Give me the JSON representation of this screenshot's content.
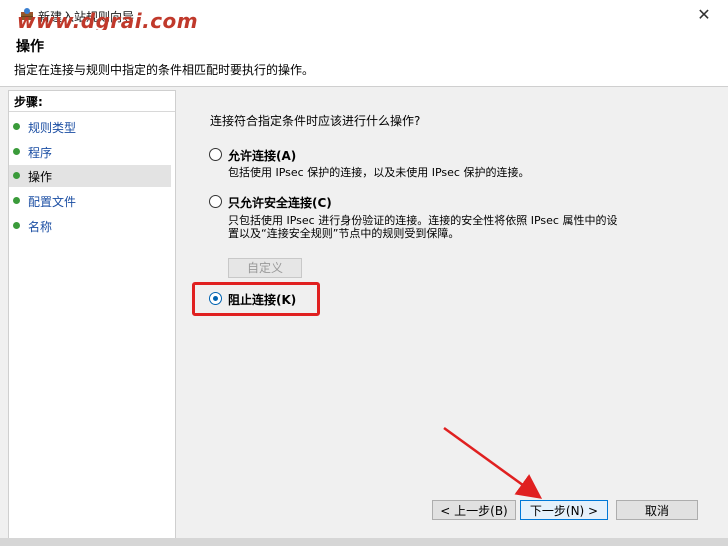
{
  "window": {
    "title": "新建入站规则向导"
  },
  "watermark": "www.dgrai.com",
  "header": {
    "title": "操作",
    "description": "指定在连接与规则中指定的条件相匹配时要执行的操作。"
  },
  "sidebar": {
    "heading": "步骤:",
    "items": [
      {
        "label": "规则类型"
      },
      {
        "label": "程序"
      },
      {
        "label": "操作"
      },
      {
        "label": "配置文件"
      },
      {
        "label": "名称"
      }
    ]
  },
  "main": {
    "question": "连接符合指定条件时应该进行什么操作?",
    "options": [
      {
        "label": "允许连接(A)",
        "description": "包括使用 IPsec 保护的连接，以及未使用 IPsec 保护的连接。",
        "selected": false
      },
      {
        "label": "只允许安全连接(C)",
        "description_line1": "只包括使用 IPsec 进行身份验证的连接。连接的安全性将依照 IPsec 属性中的设",
        "description_line2": "置以及“连接安全规则”节点中的规则受到保障。",
        "selected": false
      },
      {
        "label": "阻止连接(K)",
        "selected": true
      }
    ],
    "customize_label": "自定义"
  },
  "footer": {
    "back_label": "< 上一步(B)",
    "next_label": "下一步(N) >",
    "cancel_label": "取消"
  },
  "colors": {
    "accent": "#0063b1",
    "annotation": "#e02020",
    "step_dot": "#3a9b3a"
  }
}
